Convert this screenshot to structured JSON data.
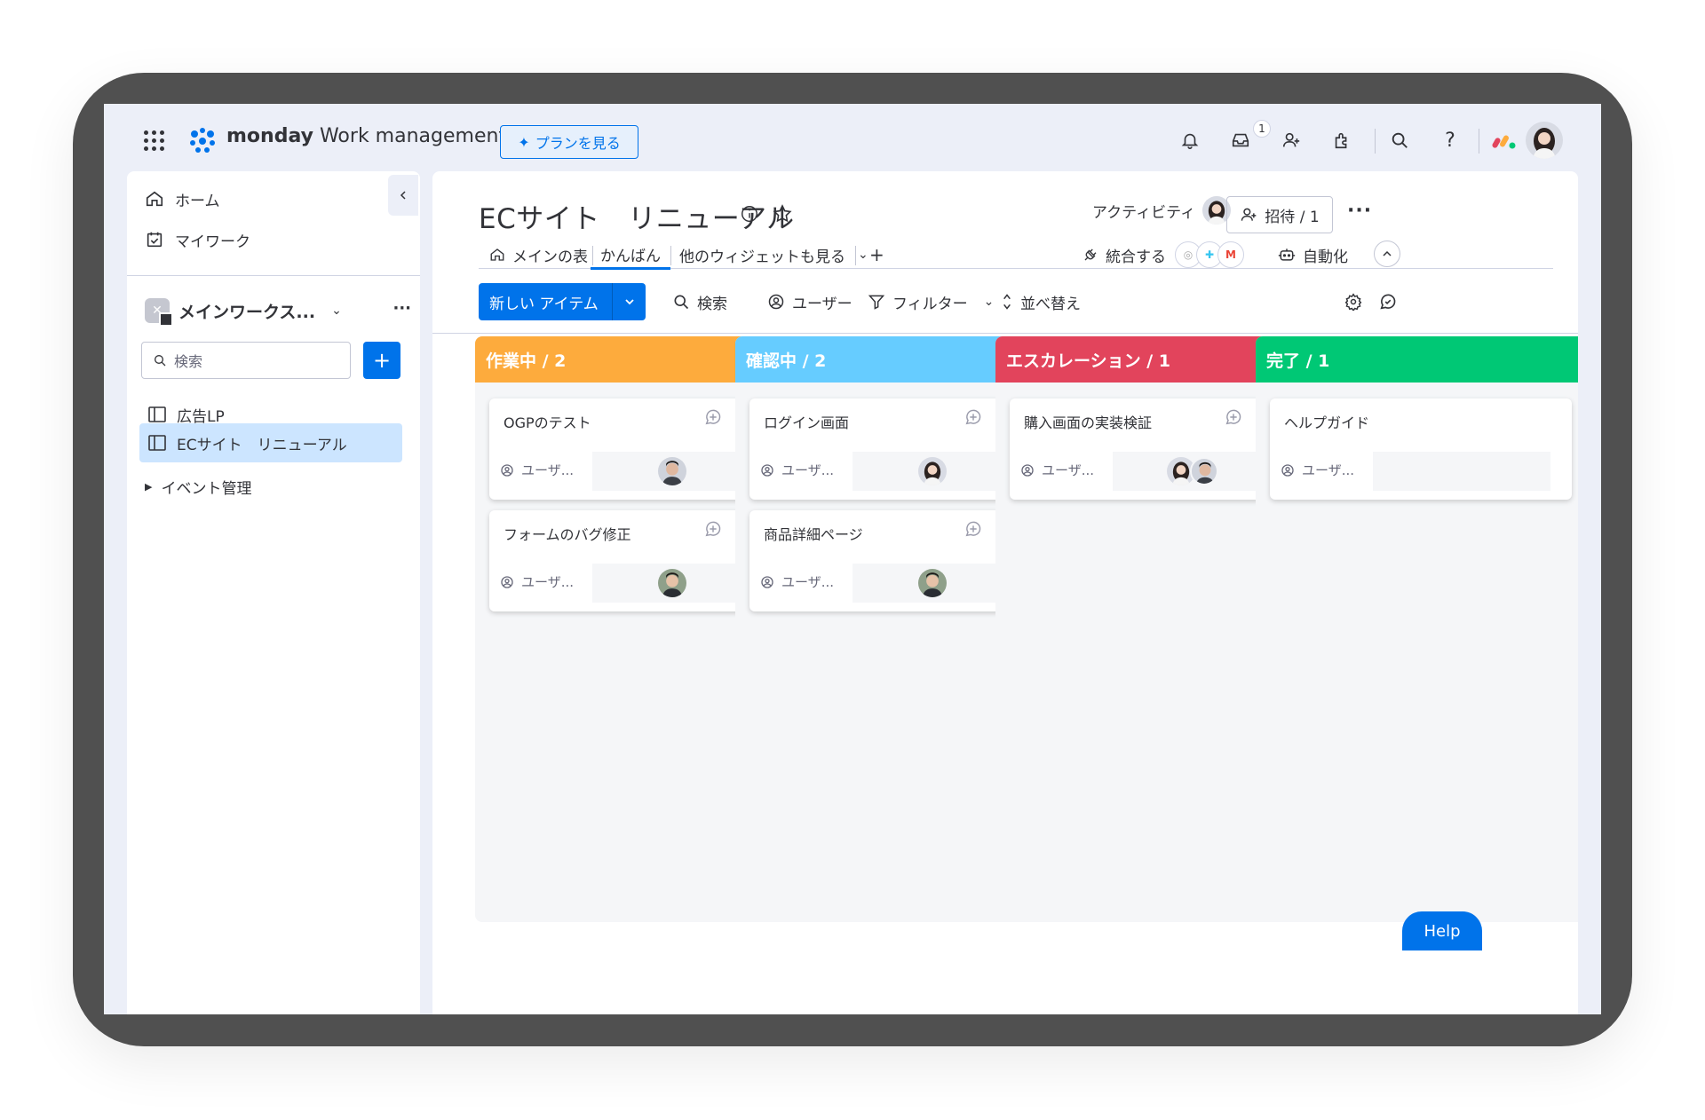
{
  "topbar": {
    "brand_bold": "monday",
    "brand_rest": "Work management",
    "plan_button": "プランを見る",
    "inbox_badge": "1",
    "icons": [
      "apps-grid-icon",
      "bell-icon",
      "inbox-icon",
      "invite-user-icon",
      "integrations-icon",
      "search-icon",
      "help-icon"
    ]
  },
  "sidebar": {
    "home": "ホーム",
    "my_work": "マイワーク",
    "workspace_name": "メインワークス...",
    "search_placeholder": "検索",
    "add_label": "+",
    "boards": [
      {
        "label": "広告LP",
        "active": false
      },
      {
        "label": "ECサイト　リニューアル",
        "active": true
      }
    ],
    "folder": "イベント管理"
  },
  "board": {
    "title": "ECサイト　リニューアル",
    "activity": "アクティビティ",
    "invite": "招待 / 1",
    "tabs": {
      "main_table": "メインの表",
      "kanban": "かんばん",
      "more_widgets": "他のウィジェットも見る",
      "add": "+"
    },
    "integrate": "統合する",
    "automate": "自動化"
  },
  "toolbar": {
    "new_item": "新しい アイテム",
    "search": "検索",
    "user": "ユーザー",
    "filter": "フィルター",
    "sort": "並べ替え"
  },
  "columns": [
    {
      "title": "作業中 / 2",
      "color": "#fdab3d",
      "cards": [
        {
          "title": "OGPのテスト",
          "user_label": "ユーザ..."
        },
        {
          "title": "フォームのバグ修正",
          "user_label": "ユーザ..."
        }
      ]
    },
    {
      "title": "確認中 / 2",
      "color": "#66ccff",
      "cards": [
        {
          "title": "ログイン画面",
          "user_label": "ユーザ..."
        },
        {
          "title": "商品詳細ページ",
          "user_label": "ユーザ..."
        }
      ]
    },
    {
      "title": "エスカレーション / 1",
      "color": "#e2445c",
      "cards": [
        {
          "title": "購入画面の実装検証",
          "user_label": "ユーザ..."
        }
      ]
    },
    {
      "title": "完了 / 1",
      "color": "#00c875",
      "cards": [
        {
          "title": "ヘルプガイド",
          "user_label": "ユーザ..."
        }
      ]
    }
  ],
  "help_button": "Help"
}
